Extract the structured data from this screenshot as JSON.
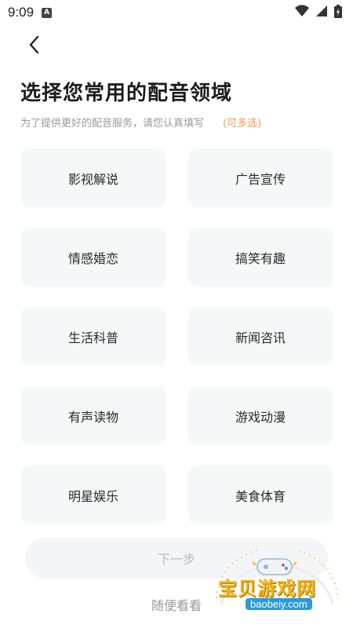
{
  "status_bar": {
    "time": "9:09",
    "app_icon_letter": "A"
  },
  "page": {
    "title": "选择您常用的配音领域",
    "subtitle": "为了提供更好的配音服务，请您认真填写",
    "multi_hint": "(可多选)"
  },
  "options": [
    "影视解说",
    "广告宣传",
    "情感婚恋",
    "搞笑有趣",
    "生活科普",
    "新闻咨讯",
    "有声读物",
    "游戏动漫",
    "明星娱乐",
    "美食体育"
  ],
  "footer": {
    "next_label": "下一步",
    "skip_label": "随便看看"
  },
  "watermark": {
    "brand": "宝贝游戏网",
    "url": "baobeiy.com"
  },
  "colors": {
    "accent_orange": "#f0a04b",
    "card_bg": "#f6f7f9"
  }
}
